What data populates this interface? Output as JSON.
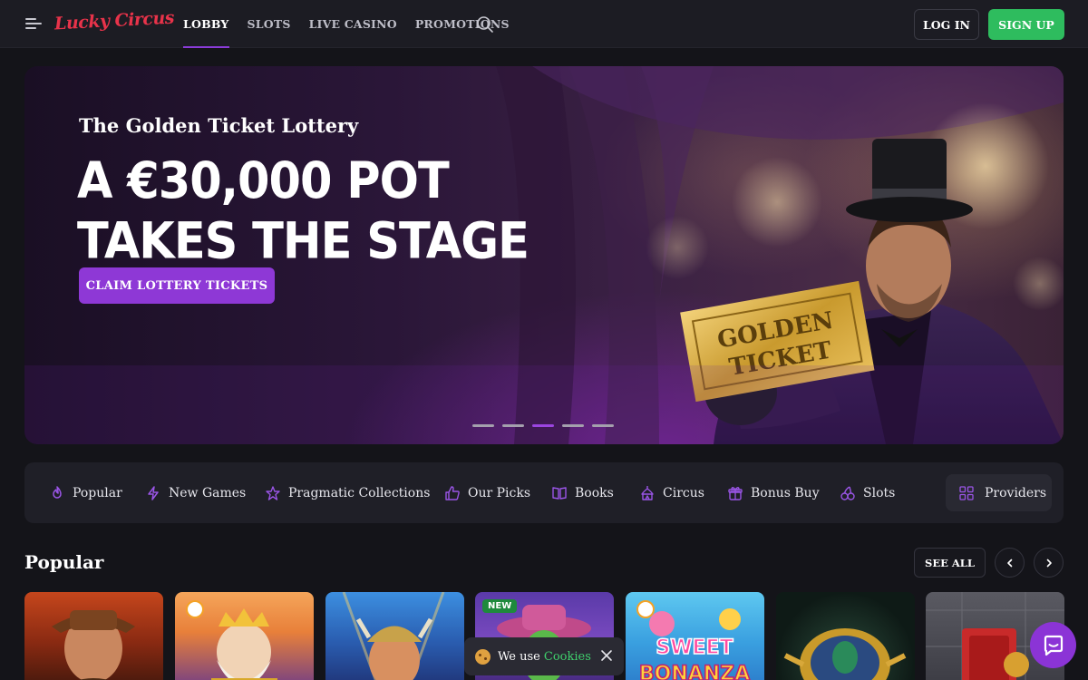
{
  "header": {
    "logo_text": "Lucky Circus",
    "nav": [
      "LOBBY",
      "SLOTS",
      "LIVE CASINO",
      "PROMOTIONS"
    ],
    "active_nav": "LOBBY",
    "login_label": "LOG IN",
    "signup_label": "SIGN UP"
  },
  "hero": {
    "kicker": "The Golden Ticket Lottery",
    "title_line1": "A €30,000 POT",
    "title_line2": "TAKES THE STAGE",
    "cta": "CLAIM LOTTERY TICKETS",
    "ticket_text_1": "GOLDEN",
    "ticket_text_2": "TICKET",
    "slides": 5,
    "active_slide": 3
  },
  "categories": {
    "items": [
      {
        "label": "Popular",
        "icon": "flame-icon"
      },
      {
        "label": "New Games",
        "icon": "lightning-icon"
      },
      {
        "label": "Pragmatic Collections",
        "icon": "star-icon"
      },
      {
        "label": "Our Picks",
        "icon": "thumbs-up-icon"
      },
      {
        "label": "Books",
        "icon": "book-icon"
      },
      {
        "label": "Circus",
        "icon": "circus-tent-icon"
      },
      {
        "label": "Bonus Buy",
        "icon": "gift-icon"
      },
      {
        "label": "Slots",
        "icon": "cherries-icon"
      }
    ],
    "providers_label": "Providers"
  },
  "popular": {
    "title": "Popular",
    "see_all_label": "SEE ALL",
    "tiles": [
      {
        "badge": ""
      },
      {
        "badge": "pp"
      },
      {
        "badge": ""
      },
      {
        "badge": "NEW"
      },
      {
        "badge": "pp",
        "title_text": "SWEET BONANZA"
      },
      {
        "badge": ""
      },
      {
        "badge": ""
      }
    ]
  },
  "cookie": {
    "text": "We use",
    "link": "Cookies"
  },
  "colors": {
    "accent": "#8e38d6",
    "signup": "#2ebc5e",
    "background": "#141419"
  }
}
